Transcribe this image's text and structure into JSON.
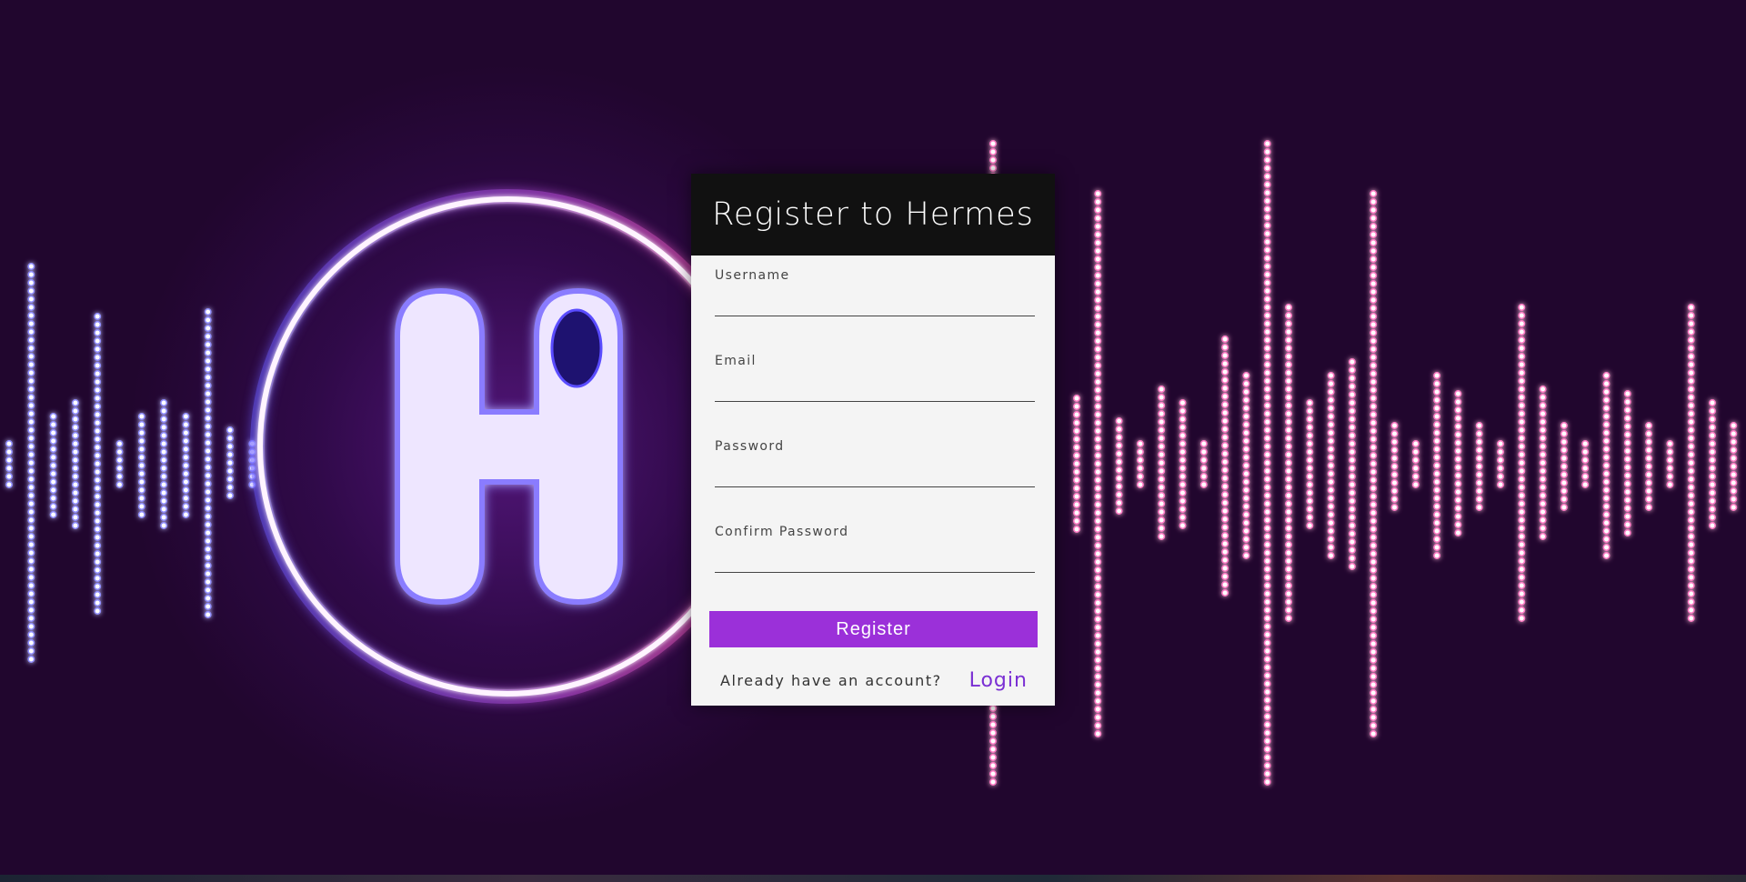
{
  "page": {
    "title": "Register to Hermes"
  },
  "logo": {
    "icon": "hermes-h-logo",
    "letter": "H"
  },
  "form": {
    "fields": [
      {
        "label": "Username",
        "value": ""
      },
      {
        "label": "Email",
        "value": ""
      },
      {
        "label": "Password",
        "value": ""
      },
      {
        "label": "Confirm Password",
        "value": ""
      }
    ],
    "submit_label": "Register",
    "login_prompt": "Already have an account?",
    "login_link": "Login"
  },
  "colors": {
    "background": "#21062e",
    "accent": "#9b30d9",
    "link": "#7a2fd3",
    "header": "#111111",
    "card": "#f4f4f4",
    "wave_left": "#8f8cff",
    "wave_right": "#ff78c4"
  }
}
